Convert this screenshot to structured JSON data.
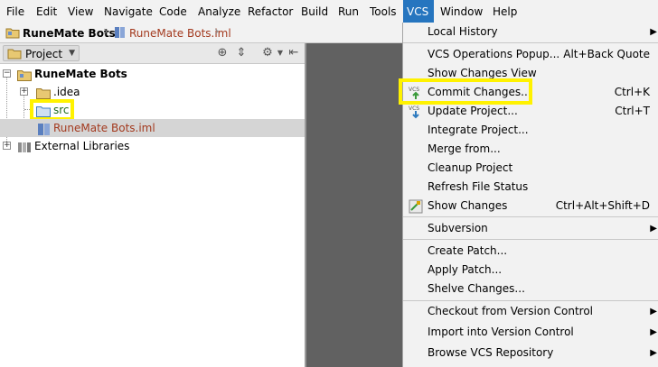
{
  "menubar": {
    "items": [
      "File",
      "Edit",
      "View",
      "Navigate",
      "Code",
      "Analyze",
      "Refactor",
      "Build",
      "Run",
      "Tools",
      "VCS",
      "Window",
      "Help"
    ],
    "active": "VCS"
  },
  "breadcrumb": {
    "project": "RuneMate Bots",
    "file": "RuneMate Bots.iml"
  },
  "tool_window": {
    "tab_label": "Project"
  },
  "tree": {
    "root": "RuneMate Bots",
    "idea": ".idea",
    "src": "src",
    "iml": "RuneMate Bots.iml",
    "external": "External Libraries"
  },
  "vcs_menu": {
    "local_history": "Local History",
    "vcs_operations": "VCS Operations Popup...",
    "vcs_operations_shortcut": "Alt+Back Quote",
    "show_changes_view": "Show Changes View",
    "commit_changes": "Commit Changes...",
    "commit_shortcut": "Ctrl+K",
    "update_project": "Update Project...",
    "update_shortcut": "Ctrl+T",
    "integrate_project": "Integrate Project...",
    "merge_from": "Merge from...",
    "cleanup_project": "Cleanup Project",
    "refresh_file_status": "Refresh File Status",
    "show_changes": "Show Changes",
    "show_changes_shortcut": "Ctrl+Alt+Shift+D",
    "subversion": "Subversion",
    "create_patch": "Create Patch...",
    "apply_patch": "Apply Patch...",
    "shelve_changes": "Shelve Changes...",
    "checkout": "Checkout from Version Control",
    "import": "Import into Version Control",
    "browse_repo": "Browse VCS Repository",
    "vcs_badge": "VCS"
  },
  "colors": {
    "accent": "#2675bf",
    "highlight": "#fff200",
    "iml_text": "#a33a1f",
    "src_folder": "#5b9bd5"
  }
}
